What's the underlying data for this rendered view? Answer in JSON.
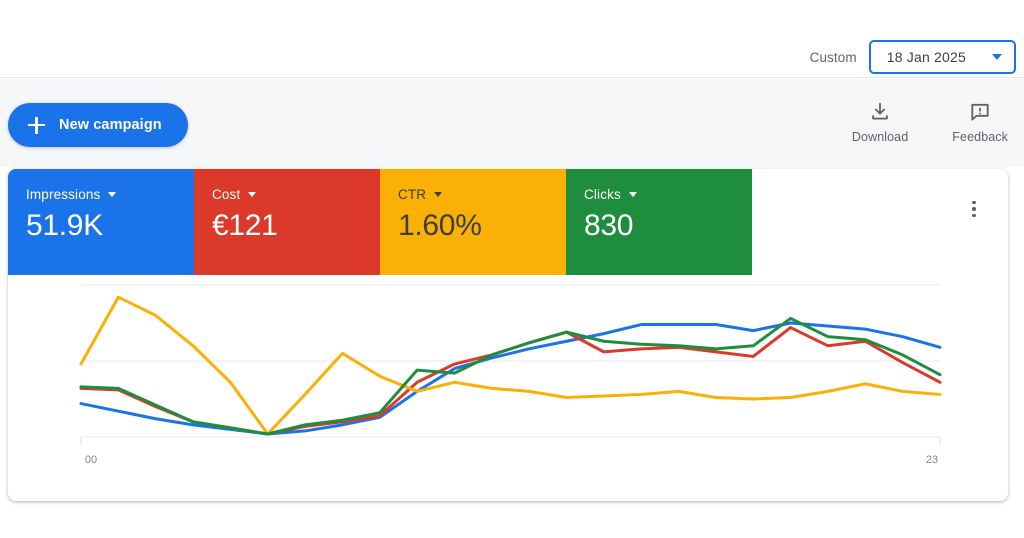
{
  "header": {
    "daterange_label": "Custom",
    "daterange_value": "18 Jan 2025",
    "caret_icon": "chevron-down-icon"
  },
  "toolbar": {
    "new_campaign_label": "New campaign",
    "plus_icon": "plus-icon",
    "actions": [
      {
        "label": "Download",
        "icon": "download-icon"
      },
      {
        "label": "Feedback",
        "icon": "feedback-icon"
      }
    ],
    "overflow_icon": "kebab-menu-icon"
  },
  "metrics": [
    {
      "label": "Impressions",
      "value": "51.9K",
      "bg": "#1a73e8",
      "fg": "#ffffff",
      "caret_icon": "chevron-down-icon"
    },
    {
      "label": "Cost",
      "value": "€121",
      "bg": "#db3a2a",
      "fg": "#ffffff",
      "caret_icon": "chevron-down-icon"
    },
    {
      "label": "CTR",
      "value": "1.60%",
      "bg": "#fab005",
      "fg": "#3c4043",
      "caret_icon": "chevron-down-icon"
    },
    {
      "label": "Clicks",
      "value": "830",
      "bg": "#1e8e3e",
      "fg": "#ffffff",
      "caret_icon": "chevron-down-icon"
    }
  ],
  "chart_data": {
    "type": "line",
    "title": "",
    "xlabel": "",
    "ylabel": "",
    "grid": true,
    "legend": "none",
    "x": [
      0,
      1,
      2,
      3,
      4,
      5,
      6,
      7,
      8,
      9,
      10,
      11,
      12,
      13,
      14,
      15,
      16,
      17,
      18,
      19,
      20,
      21,
      22,
      23
    ],
    "tick_labels": {
      "first": "00",
      "last": "23"
    },
    "xlim": [
      0,
      23
    ],
    "ylim": [
      0,
      100
    ],
    "series": [
      {
        "name": "Impressions",
        "color": "#1a73e8",
        "values": [
          22,
          17,
          12,
          8,
          5,
          2,
          4,
          8,
          13,
          30,
          45,
          52,
          58,
          63,
          68,
          74,
          74,
          74,
          70,
          75,
          73,
          71,
          66,
          59
        ]
      },
      {
        "name": "Cost",
        "color": "#db3a2a",
        "values": [
          32,
          31,
          20,
          10,
          6,
          2,
          7,
          10,
          14,
          36,
          48,
          54,
          62,
          69,
          56,
          58,
          59,
          56,
          53,
          72,
          60,
          63,
          49,
          36
        ]
      },
      {
        "name": "CTR",
        "color": "#fab005",
        "values": [
          48,
          92,
          80,
          60,
          36,
          2,
          28,
          55,
          40,
          30,
          36,
          32,
          30,
          26,
          27,
          28,
          30,
          26,
          25,
          26,
          30,
          35,
          30,
          28
        ]
      },
      {
        "name": "Clicks",
        "color": "#1e8e3e",
        "values": [
          33,
          32,
          21,
          10,
          6,
          2,
          8,
          11,
          16,
          44,
          42,
          54,
          62,
          69,
          63,
          61,
          60,
          58,
          60,
          78,
          66,
          64,
          54,
          41
        ]
      }
    ]
  }
}
